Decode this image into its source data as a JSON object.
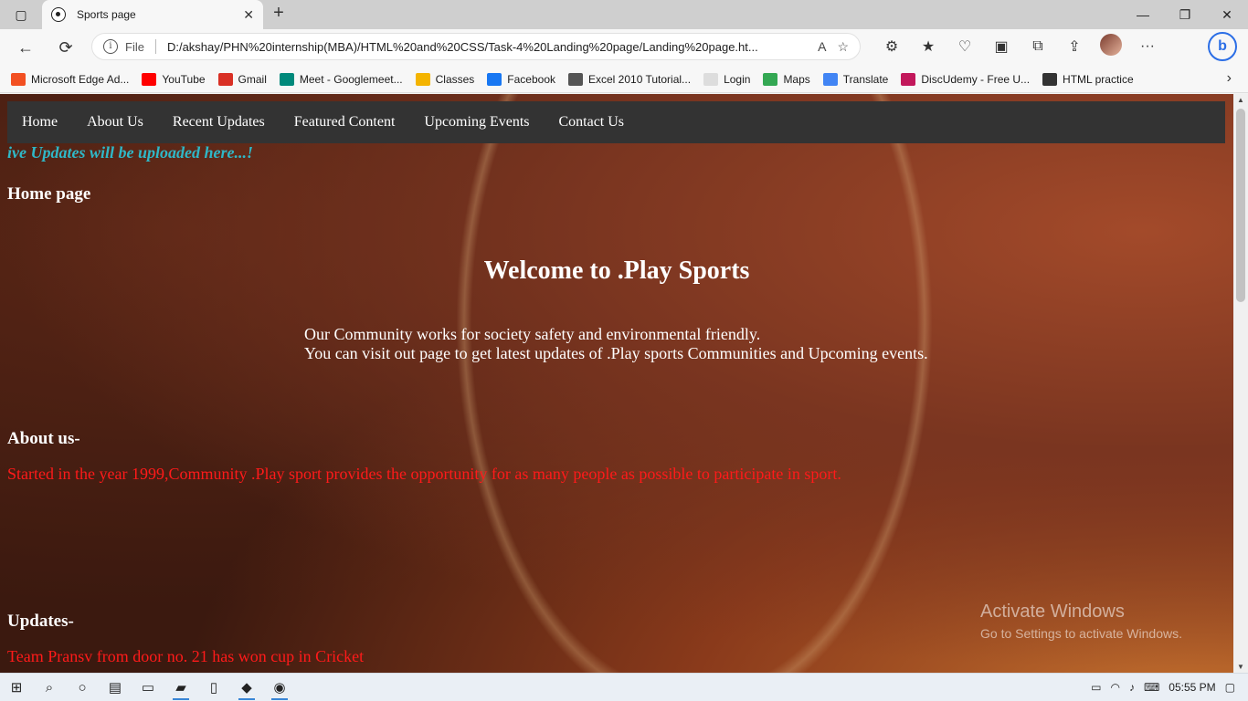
{
  "browser": {
    "tab_title": "Sports page",
    "close_tab": "✕",
    "new_tab": "+",
    "window_controls": {
      "minimize": "—",
      "restore": "❐",
      "close": "✕"
    },
    "protocol": "File",
    "url": "D:/akshay/PHN%20internship(MBA)/HTML%20and%20CSS/Task-4%20Landing%20page/Landing%20page.ht...",
    "bookmarks": [
      {
        "label": "Microsoft Edge Ad...",
        "color": "#f25022"
      },
      {
        "label": "YouTube",
        "color": "#ff0000"
      },
      {
        "label": "Gmail",
        "color": "#d93025"
      },
      {
        "label": "Meet - Googlemeet...",
        "color": "#00897b"
      },
      {
        "label": "Classes",
        "color": "#f4b400"
      },
      {
        "label": "Facebook",
        "color": "#1877f2"
      },
      {
        "label": "Excel 2010 Tutorial...",
        "color": "#555555"
      },
      {
        "label": "Login",
        "color": "#dddddd"
      },
      {
        "label": "Maps",
        "color": "#34a853"
      },
      {
        "label": "Translate",
        "color": "#4285f4"
      },
      {
        "label": "DiscUdemy - Free U...",
        "color": "#c2185b"
      },
      {
        "label": "HTML practice",
        "color": "#333333"
      }
    ],
    "more_bookmarks": "›"
  },
  "page": {
    "nav": [
      "Home",
      "About Us",
      "Recent Updates",
      "Featured Content",
      "Upcoming Events",
      "Contact Us"
    ],
    "ticker": "ive Updates will be uploaded here...!",
    "home_heading": "Home page",
    "welcome": "Welcome to .Play Sports",
    "intro_line1": "Our Community works for society safety and environmental friendly.",
    "intro_line2": "You can visit out page to get latest updates of .Play sports Communities and Upcoming events.",
    "about_heading": "About us-",
    "about_text": "Started in the year 1999,Community .Play sport provides the opportunity for as many people as possible to participate in sport.",
    "updates_heading": "Updates-",
    "update_text": "Team Pransv from door no. 21 has won cup in Cricket"
  },
  "watermark": {
    "line1": "Activate Windows",
    "line2": "Go to Settings to activate Windows."
  },
  "taskbar": {
    "time": "05:55 PM"
  },
  "colors": {
    "nav_bg": "#333333",
    "ticker": "#2fb8c7",
    "red_text": "#ff1a1a"
  }
}
